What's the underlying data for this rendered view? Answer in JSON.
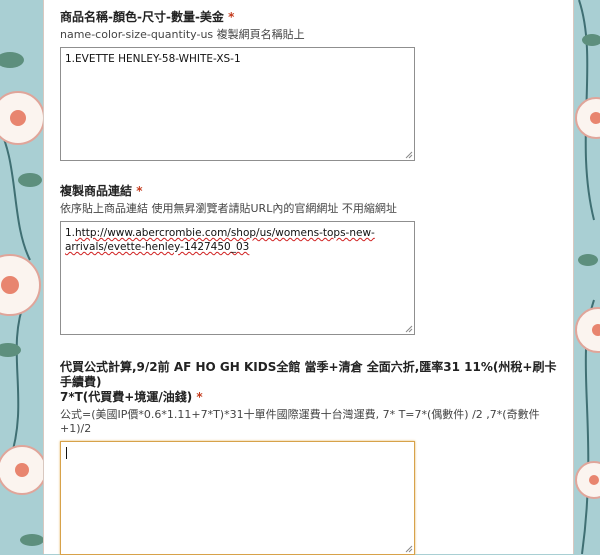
{
  "questions": [
    {
      "title": "商品名稱-顏色-尺寸-數量-美金",
      "required_mark": "*",
      "help": "name-color-size-quantity-us 複製網頁名稱貼上",
      "answer": "1.EVETTE HENLEY-58-WHITE-XS-1"
    },
    {
      "title": "複製商品連結",
      "required_mark": "*",
      "help": "依序貼上商品連結 使用無昇瀏覽者請貼URL內的官網網址 不用縮網址",
      "answer_prefix": "1.",
      "answer_url_line1": "http://www.abercrombie.com/shop/us/womens-tops-new-",
      "answer_url_line2": "arrivals/evette-henley-1427450_03"
    },
    {
      "title_line1": "代買公式計算,9/2前 AF HO GH KIDS全館 當季+清倉 全面六折,匯率31 11%(州稅+刷卡手續費)",
      "title_line2": "7*T(代買費+境運/油錢)",
      "required_mark": "*",
      "help": "公式=(美國IP價*0.6*1.11+7*T)*31十單件國際運費十台灣運費, 7* T=7*(偶數件) /2 ,7*(奇數件+1)/2",
      "answer": ""
    }
  ],
  "colors": {
    "background_pattern": "#a9cfd3",
    "required": "#c43b1d",
    "focus_border": "#d7a24a"
  }
}
